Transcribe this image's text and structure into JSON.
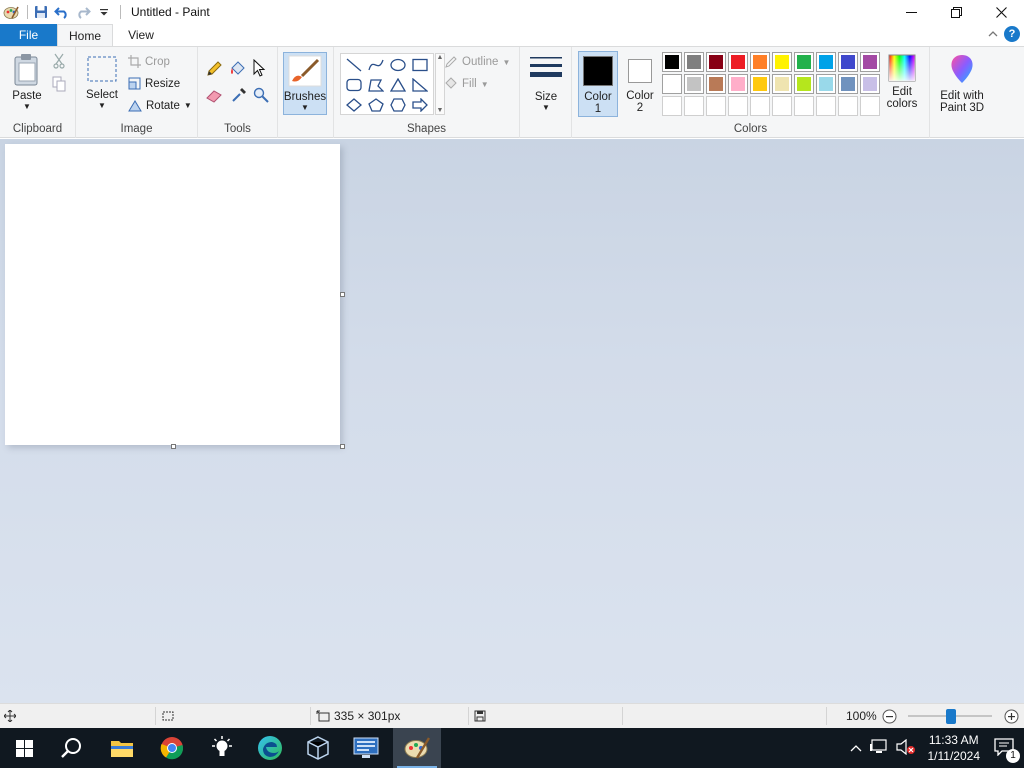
{
  "window": {
    "title": "Untitled - Paint"
  },
  "tabs": {
    "file": "File",
    "home": "Home",
    "view": "View"
  },
  "clipboard": {
    "paste": "Paste",
    "group": "Clipboard"
  },
  "image": {
    "select": "Select",
    "crop": "Crop",
    "resize": "Resize",
    "rotate": "Rotate",
    "group": "Image"
  },
  "tools": {
    "group": "Tools"
  },
  "brushes": {
    "label": "Brushes"
  },
  "shapes": {
    "outline": "Outline",
    "fill": "Fill",
    "group": "Shapes"
  },
  "size": {
    "label": "Size"
  },
  "colors": {
    "color1_line1": "Color",
    "color1_line2": "1",
    "color2_line1": "Color",
    "color2_line2": "2",
    "edit_line1": "Edit",
    "edit_line2": "colors",
    "paint3d_line1": "Edit with",
    "paint3d_line2": "Paint 3D",
    "group": "Colors",
    "color1_value": "#000000",
    "color2_value": "#ffffff",
    "palette_row1": [
      "#000000",
      "#7f7f7f",
      "#880015",
      "#ed1c24",
      "#ff7f27",
      "#fff200",
      "#22b14c",
      "#00a2e8",
      "#3f48cc",
      "#a349a4"
    ],
    "palette_row2": [
      "#ffffff",
      "#c3c3c3",
      "#b97a57",
      "#ffaec9",
      "#ffc90e",
      "#efe4b0",
      "#b5e61d",
      "#99d9ea",
      "#7092be",
      "#c8bfe7"
    ]
  },
  "status": {
    "dimensions": "335 × 301px",
    "zoom": "100%"
  },
  "taskbar": {
    "time": "11:33 AM",
    "date": "1/11/2024",
    "notifications": "1"
  }
}
